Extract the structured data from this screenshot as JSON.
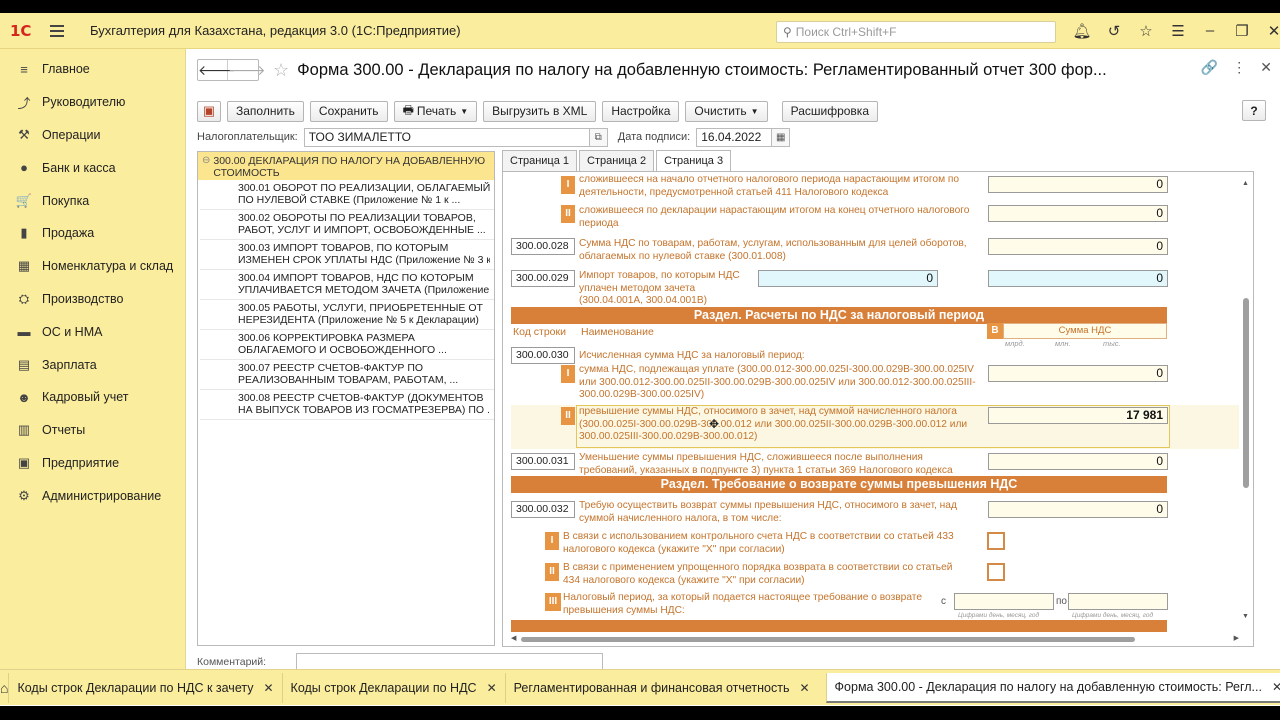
{
  "app": {
    "logo": "1С",
    "title": "Бухгалтерия для Казахстана, редакция 3.0  (1С:Предприятие)",
    "search_placeholder": "Поиск Ctrl+Shift+F",
    "icons": [
      "bell-icon",
      "history-icon",
      "star-icon",
      "settings-icon",
      "minimize-icon",
      "restore-icon",
      "close-icon"
    ]
  },
  "sidebar": {
    "items": [
      {
        "icon": "≡",
        "label": "Главное"
      },
      {
        "icon": "⤴",
        "label": "Руководителю"
      },
      {
        "icon": "⚒",
        "label": "Операции"
      },
      {
        "icon": "●",
        "label": "Банк и касса"
      },
      {
        "icon": "🛒",
        "label": "Покупка"
      },
      {
        "icon": "▮",
        "label": "Продажа"
      },
      {
        "icon": "▦",
        "label": "Номенклатура и склад"
      },
      {
        "icon": "⛭",
        "label": "Производство"
      },
      {
        "icon": "▬",
        "label": "ОС и НМА"
      },
      {
        "icon": "▤",
        "label": "Зарплата"
      },
      {
        "icon": "☻",
        "label": "Кадровый учет"
      },
      {
        "icon": "▥",
        "label": "Отчеты"
      },
      {
        "icon": "▣",
        "label": "Предприятие"
      },
      {
        "icon": "⚙",
        "label": "Администрирование"
      }
    ]
  },
  "header": {
    "back": "🡐",
    "forward": "🡒",
    "title": "Форма 300.00 - Декларация по налогу на добавленную стоимость: Регламентированный отчет 300 фор...",
    "link_icon": "🔗",
    "more_icon": "⋮",
    "close_icon": "✕"
  },
  "toolbar": {
    "fill": "Заполнить",
    "save": "Сохранить",
    "print": "Печать",
    "export_xml": "Выгрузить в XML",
    "settings": "Настройка",
    "clear": "Очистить",
    "decode": "Расшифровка",
    "help": "?"
  },
  "payer": {
    "label": "Налогоплательщик:",
    "value": "ТОО ЗИМАЛЕТТО",
    "date_label": "Дата подписи:",
    "date_value": "16.04.2022"
  },
  "tree": {
    "root": "300.00 ДЕКЛАРАЦИЯ ПО НАЛОГУ НА ДОБАВЛЕННУЮ СТОИМОСТЬ",
    "items": [
      {
        "l1": "300.01 ОБОРОТ ПО РЕАЛИЗАЦИИ, ОБЛАГАЕМЫЙ",
        "l2": "ПО НУЛЕВОЙ СТАВКЕ (Приложение № 1 к ..."
      },
      {
        "l1": "300.02 ОБОРОТЫ ПО  РЕАЛИЗАЦИИ ТОВАРОВ,",
        "l2": "РАБОТ, УСЛУГ И ИМПОРТ, ОСВОБОЖДЕННЫЕ ..."
      },
      {
        "l1": "300.03 ИМПОРТ ТОВАРОВ, ПО КОТОРЫМ",
        "l2": "ИЗМЕНЕН СРОК УПЛАТЫ НДС (Приложение № 3 к"
      },
      {
        "l1": "300.04 ИМПОРТ ТОВАРОВ, НДС ПО КОТОРЫМ",
        "l2": "УПЛАЧИВАЕТСЯ МЕТОДОМ ЗАЧЕТА (Приложение"
      },
      {
        "l1": "300.05 РАБОТЫ, УСЛУГИ, ПРИОБРЕТЕННЫЕ ОТ",
        "l2": "НЕРЕЗИДЕНТА (Приложение № 5 к Декларации)"
      },
      {
        "l1": "300.06 КОРРЕКТИРОВКА РАЗМЕРА",
        "l2": "ОБЛАГАЕМОГО И ОСВОБОЖДЕННОГО ..."
      },
      {
        "l1": "300.07 РЕЕСТР СЧЕТОВ-ФАКТУР ПО",
        "l2": "РЕАЛИЗОВАННЫМ ТОВАРАМ, РАБОТАМ, ..."
      },
      {
        "l1": "300.08 РЕЕСТР СЧЕТОВ-ФАКТУР (ДОКУМЕНТОВ",
        "l2": "НА ВЫПУСК ТОВАРОВ ИЗ ГОСМАТРЕЗЕРВА) ПО ..."
      }
    ]
  },
  "tabs": [
    "Страница 1",
    "Страница 2",
    "Страница 3"
  ],
  "form": {
    "r_top_i": {
      "num": "I",
      "desc": "сложившееся на начало отчетного налогового периода нарастающим итогом по деятельности, предусмотренной статьей 411 Налогового кодекса",
      "value": "0"
    },
    "r_top_ii": {
      "num": "II",
      "desc": "сложившееся по декларации нарастающим итогом на конец отчетного налогового периода",
      "value": "0"
    },
    "r028": {
      "code": "300.00.028",
      "desc": "Сумма НДС по товарам, работам, услугам, использованным для целей оборотов, облагаемых по нулевой ставке (300.01.008)",
      "value": "0"
    },
    "r029": {
      "code": "300.00.029",
      "desc": "Импорт товаров, по которым НДС уплачен методом зачета (300.04.001A, 300.04.001B)",
      "value_a": "0",
      "value_b": "0"
    },
    "section1": "Раздел. Расчеты по НДС за налоговый период",
    "col_code": "Код строки",
    "col_name": "Наименование",
    "col_b": "B",
    "col_sum": "Сумма НДС",
    "units": [
      "млрд.",
      "млн.",
      "тыс."
    ],
    "r030": {
      "code": "300.00.030",
      "desc": "Исчисленная сумма НДС за налоговый период:"
    },
    "r030_i": {
      "num": "I",
      "desc": "сумма НДС, подлежащая уплате (300.00.012-300.00.025I-300.00.029B-300.00.025IV или 300.00.012-300.00.025II-300.00.029B-300.00.025IV или 300.00.012-300.00.025III-300.00.029B-300.00.025IV)",
      "value": "0"
    },
    "r030_ii": {
      "num": "II",
      "desc": "превышение суммы НДС, относимого в зачет, над суммой начисленного налога (300.00.025I-300.00.029B-300.00.012 или 300.00.025II-300.00.029B-300.00.012 или 300.00.025III-300.00.029B-300.00.012)",
      "value": "17 981"
    },
    "r031": {
      "code": "300.00.031",
      "desc": "Уменьшение суммы превышения НДС, сложившееся после выполнения требований, указанных в подпункте 3) пункта 1 статьи 369 Налогового кодекса",
      "value": "0"
    },
    "section2": "Раздел. Требование о возврате суммы превышения НДС",
    "r032": {
      "code": "300.00.032",
      "desc": "Требую осуществить возврат суммы превышения НДС, относимого в зачет, над суммой начисленного налога, в том числе:",
      "value": "0"
    },
    "r032_i": {
      "num": "I",
      "desc": "В связи с использованием контрольного счета НДС в соответствии со статьей 433 налогового кодекса (укажите \"X\" при согласии)"
    },
    "r032_ii": {
      "num": "II",
      "desc": "В связи с применением упрощенного порядка возврата в соответствии со статьей 434 налогового кодекса (укажите \"X\" при согласии)"
    },
    "r032_iii": {
      "num": "III",
      "desc": "Налоговый период, за который подается настоящее требование о возврате превышения суммы НДС:",
      "from": "с",
      "to": "по",
      "hint": "Цифрами день, месяц, год"
    }
  },
  "comment_label": "Комментарий:",
  "bottom_tabs": [
    {
      "label": "Коды строк Декларации по НДС к зачету",
      "active": false
    },
    {
      "label": "Коды строк Декларации по НДС",
      "active": false
    },
    {
      "label": "Регламентированная и финансовая отчетность",
      "active": false
    },
    {
      "label": "Форма 300.00 - Декларация по налогу на добавленную стоимость: Регл...",
      "active": true
    }
  ]
}
